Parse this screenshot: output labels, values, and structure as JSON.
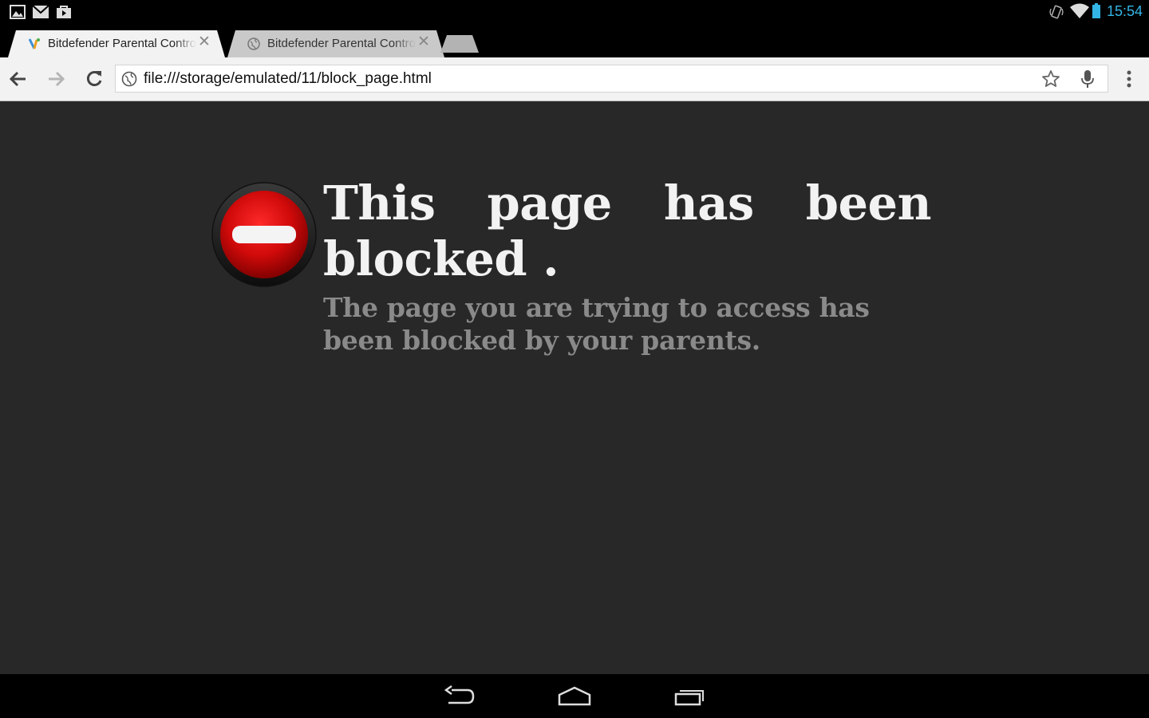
{
  "status_bar": {
    "time": "15:54",
    "left_icons": [
      "gallery-icon",
      "gmail-icon",
      "play-store-icon"
    ],
    "right_icons": [
      "vibrate-icon",
      "wifi-icon",
      "battery-icon"
    ]
  },
  "tabs": [
    {
      "title": "Bitdefender Parental Control",
      "favicon": "bitdefender-icon",
      "active": true
    },
    {
      "title": "Bitdefender Parental Control",
      "favicon": "globe-icon",
      "active": false
    }
  ],
  "toolbar": {
    "url": "file:///storage/emulated/11/block_page.html"
  },
  "page": {
    "heading": "This page has been blocked .",
    "subtext": "The page you are trying to access has been blocked by your parents."
  },
  "colors": {
    "clock": "#33b5e5",
    "content_bg": "#282828",
    "block_red": "#d10a0a"
  }
}
